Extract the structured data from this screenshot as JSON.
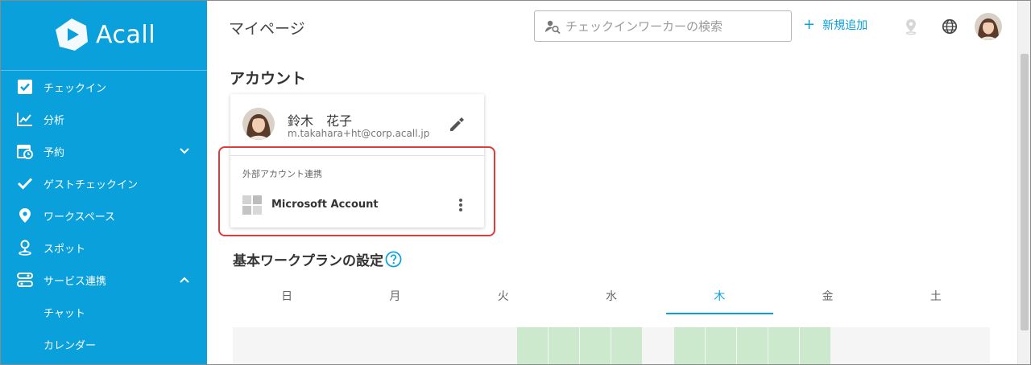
{
  "app": {
    "brand": "Acall",
    "page_title": "マイページ"
  },
  "colors": {
    "brand": "#0aa0dc",
    "highlight": "#e03b3b",
    "active_slot": "#cde9cd"
  },
  "sidebar": {
    "items": [
      {
        "label": "チェックイン",
        "icon": "checkbox-icon"
      },
      {
        "label": "分析",
        "icon": "chart-line-icon"
      },
      {
        "label": "予約",
        "icon": "calendar-clock-icon",
        "chevron": "down"
      },
      {
        "label": "ゲストチェックイン",
        "icon": "check-icon"
      },
      {
        "label": "ワークスペース",
        "icon": "map-pin-icon"
      },
      {
        "label": "スポット",
        "icon": "person-pin-icon"
      },
      {
        "label": "サービス連携",
        "icon": "integration-icon",
        "chevron": "up"
      }
    ],
    "sub_items": [
      {
        "label": "チャット"
      },
      {
        "label": "カレンダー"
      }
    ]
  },
  "header": {
    "search_placeholder": "チェックインワーカーの検索",
    "add_label": "新規追加",
    "icons": [
      "location-icon",
      "globe-icon",
      "user-avatar"
    ]
  },
  "account": {
    "section_title": "アカウント",
    "name": "鈴木　花子",
    "email": "m.takahara+ht@corp.acall.jp",
    "external_label": "外部アカウント連携",
    "external_account": "Microsoft Account"
  },
  "workplan": {
    "title": "基本ワークプランの設定",
    "days": [
      "日",
      "月",
      "火",
      "水",
      "木",
      "金",
      "土"
    ],
    "active_day": "木"
  }
}
